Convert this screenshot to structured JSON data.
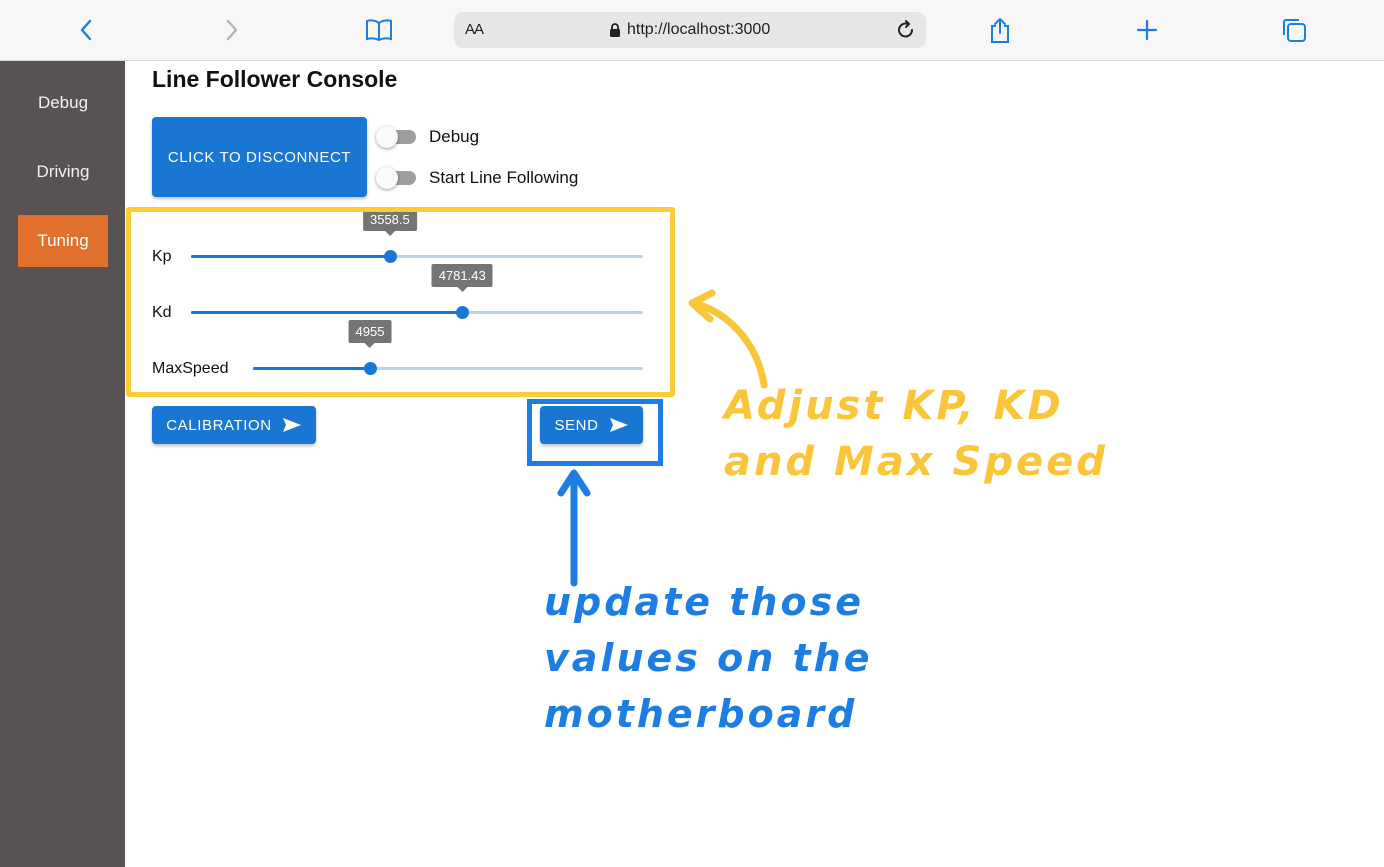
{
  "browser": {
    "url": "http://localhost:3000",
    "aa_label": "AA"
  },
  "sidebar": {
    "items": [
      {
        "label": "Debug",
        "active": false
      },
      {
        "label": "Driving",
        "active": false
      },
      {
        "label": "Tuning",
        "active": true
      }
    ]
  },
  "main": {
    "title": "Line Follower Console",
    "disconnect_label": "CLICK TO DISCONNECT",
    "toggles": [
      {
        "label": "Debug",
        "on": false
      },
      {
        "label": "Start Line Following",
        "on": false
      }
    ],
    "sliders": [
      {
        "label": "Kp",
        "value": "3558.5",
        "fraction": 0.44
      },
      {
        "label": "Kd",
        "value": "4781.43",
        "fraction": 0.6
      },
      {
        "label": "MaxSpeed",
        "value": "4955",
        "fraction": 0.3
      }
    ],
    "calibration_label": "CALIBRATION",
    "send_label": "SEND"
  },
  "annotations": {
    "yellow_text": "Adjust KP, KD and Max Speed",
    "blue_text": "update those values on the motherboard"
  },
  "colors": {
    "accent": "#1976d2",
    "sidebar_bg": "#595253",
    "active_tab": "#e2702d",
    "annotation_yellow": "#fbcb3a",
    "annotation_blue": "#1c7de3"
  }
}
